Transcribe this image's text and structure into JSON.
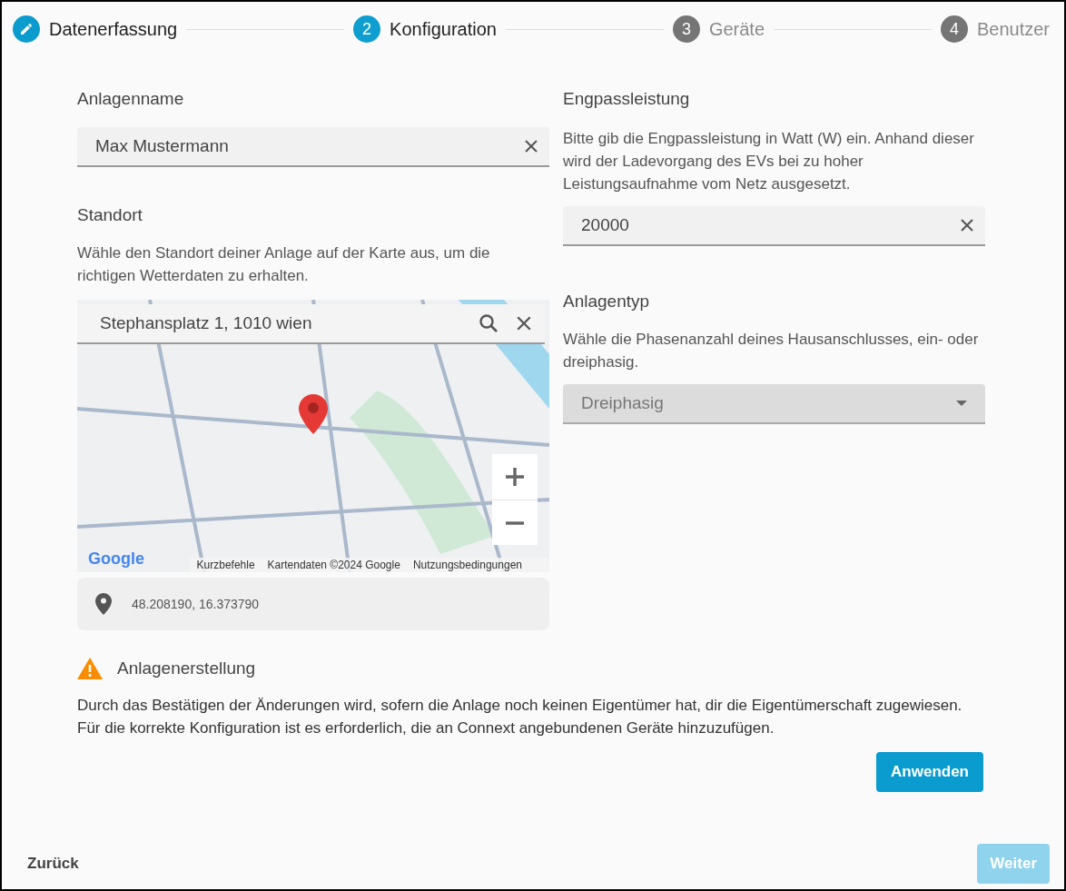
{
  "stepper": [
    {
      "label": "Datenerfassung",
      "completed": true,
      "selected": false
    },
    {
      "number": "2",
      "label": "Konfiguration",
      "completed": false,
      "selected": true
    },
    {
      "number": "3",
      "label": "Geräte",
      "completed": false,
      "selected": false
    },
    {
      "number": "4",
      "label": "Benutzer",
      "completed": false,
      "selected": false
    }
  ],
  "left": {
    "name_section": {
      "title": "Anlagenname",
      "value": "Max Mustermann"
    },
    "location": {
      "title": "Standort",
      "description": "Wähle den Standort deiner Anlage auf der Karte aus, um die richtigen Wetterdaten zu erhalten.",
      "map": {
        "search_value": "Stephansplatz 1, 1010 wien",
        "logo": "Google",
        "attribution": [
          "Kurzbefehle",
          "Kartendaten ©2024 Google",
          "Nutzungsbedingungen"
        ]
      },
      "coordinates": "48.208190, 16.373790"
    }
  },
  "right": {
    "power": {
      "title": "Engpassleistung",
      "description": "Bitte gib die Engpassleistung in Watt (W) ein. Anhand dieser wird der Ladevorgang des EVs bei zu hoher Leistungsaufnahme vom Netz ausgesetzt.",
      "value": "20000"
    },
    "type": {
      "title": "Anlagentyp",
      "description": "Wähle die Phasenanzahl deines Hausanschlusses, ein- oder dreiphasig.",
      "value": "Dreiphasig"
    }
  },
  "notice": {
    "title": "Anlagenerstellung",
    "text": "Durch das Bestätigen der Änderungen wird, sofern die Anlage noch keinen Eigentümer hat, dir die Eigentümerschaft zugewiesen. Für die korrekte Konfiguration ist es erforderlich, die an Connext angebundenen Geräte hinzuzufügen.",
    "button": "Anwenden"
  },
  "footer": {
    "back": "Zurück",
    "next": {
      "label": "Weiter",
      "disabled": true
    }
  }
}
